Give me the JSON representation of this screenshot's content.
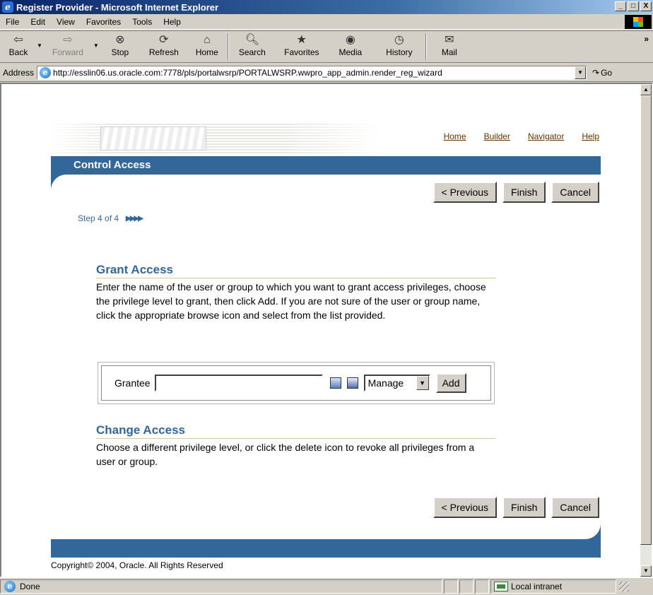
{
  "window": {
    "title": "Register Provider - Microsoft Internet Explorer",
    "min": "_",
    "max": "□",
    "close": "X"
  },
  "menu": [
    "File",
    "Edit",
    "View",
    "Favorites",
    "Tools",
    "Help"
  ],
  "toolbar": {
    "back": "Back",
    "forward": "Forward",
    "stop": "Stop",
    "refresh": "Refresh",
    "home": "Home",
    "search": "Search",
    "favorites": "Favorites",
    "media": "Media",
    "history": "History",
    "mail": "Mail",
    "more": "»"
  },
  "address": {
    "label": "Address",
    "url": "http://esslin06.us.oracle.com:7778/pls/portalwsrp/PORTALWSRP.wwpro_app_admin.render_reg_wizard",
    "go": "Go"
  },
  "page": {
    "links": [
      "Home",
      "Builder",
      "Navigator",
      "Help"
    ],
    "header_title": "Control Access",
    "buttons": {
      "previous": "< Previous",
      "finish": "Finish",
      "cancel": "Cancel"
    },
    "step_text": "Step 4 of 4",
    "step_arrows": "▶▶▶▶",
    "grant": {
      "heading": "Grant Access",
      "description": "Enter the name of the user or group to which you want to grant access privileges, choose the privilege level to grant, then click Add. If you are not sure of the user or group name, click the appropriate browse icon and select from the list provided.",
      "grantee_label": "Grantee",
      "grantee_value": "",
      "privilege": "Manage",
      "add": "Add"
    },
    "change": {
      "heading": "Change Access",
      "description": "Choose a different privilege level, or click the delete icon to revoke all privileges from a user or group."
    },
    "copyright": "Copyright© 2004, Oracle. All Rights Reserved"
  },
  "status": {
    "text": "Done",
    "zone": "Local intranet"
  }
}
